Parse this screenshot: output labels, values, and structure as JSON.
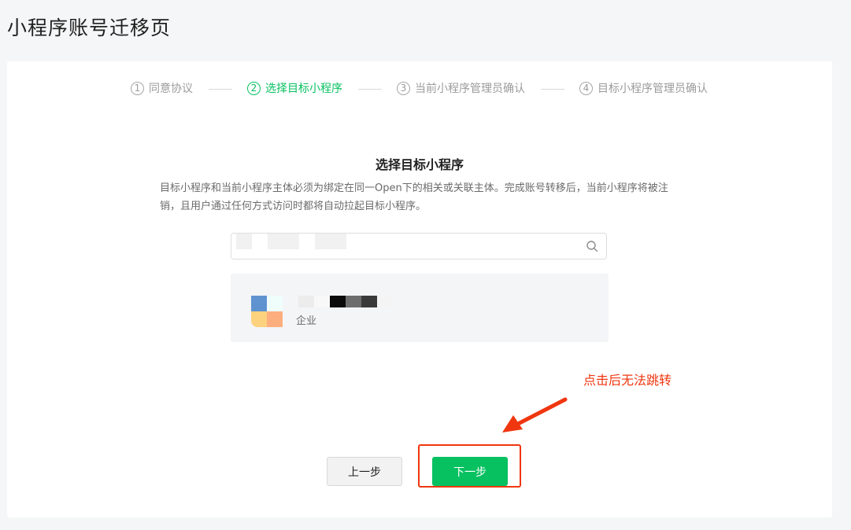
{
  "page": {
    "title": "小程序账号迁移页"
  },
  "stepper": {
    "steps": [
      {
        "number": "1",
        "label": "同意协议",
        "active": false
      },
      {
        "number": "2",
        "label": "选择目标小程序",
        "active": true
      },
      {
        "number": "3",
        "label": "当前小程序管理员确认",
        "active": false
      },
      {
        "number": "4",
        "label": "目标小程序管理员确认",
        "active": false
      }
    ]
  },
  "content": {
    "section_title": "选择目标小程序",
    "description": "目标小程序和当前小程序主体必须为绑定在同一Open下的相关或关联主体。完成账号转移后，当前小程序将被注销，且用户通过任何方式访问时都将自动拉起目标小程序。"
  },
  "search": {
    "value": "",
    "icon": "search-icon"
  },
  "result": {
    "org_type": "企业",
    "avatar_colors": [
      "#5f93d0",
      "#effdfb",
      "#fcd27e",
      "#fdae7e"
    ]
  },
  "annotation": {
    "text": "点击后无法跳转",
    "color": "#f0360f"
  },
  "buttons": {
    "prev_label": "上一步",
    "next_label": "下一步"
  },
  "colors": {
    "accent": "#07c160",
    "annotation": "#f0360f"
  }
}
